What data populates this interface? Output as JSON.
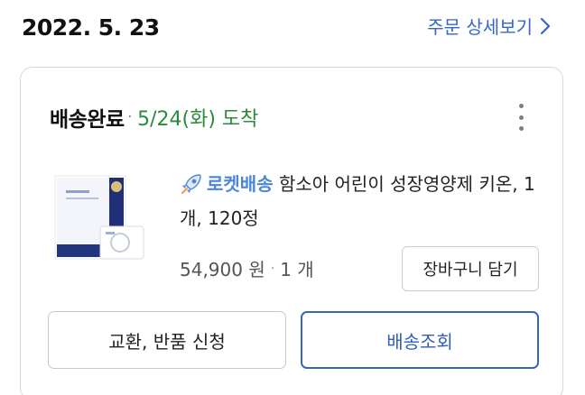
{
  "order": {
    "date": "2022. 5. 23",
    "detail_link_label": "주문 상세보기"
  },
  "shipment": {
    "status": "배송완료",
    "separator": "·",
    "arrival": "5/24(화) 도착",
    "status_color": "#2b8a3e"
  },
  "product": {
    "badge_label": "로켓배송",
    "badge_icon": "rocket-icon",
    "name": "함소아 어린이 성장영양제 키온, 1개, 120정",
    "price": "54,900 원",
    "qty_separator": "·",
    "quantity": "1 개",
    "cart_button_label": "장바구니 담기"
  },
  "actions": {
    "exchange_return_label": "교환, 반품 신청",
    "track_label": "배송조회"
  },
  "colors": {
    "link": "#3466c8",
    "rocket": "#4b87d6",
    "track_border": "#3a64b8"
  }
}
